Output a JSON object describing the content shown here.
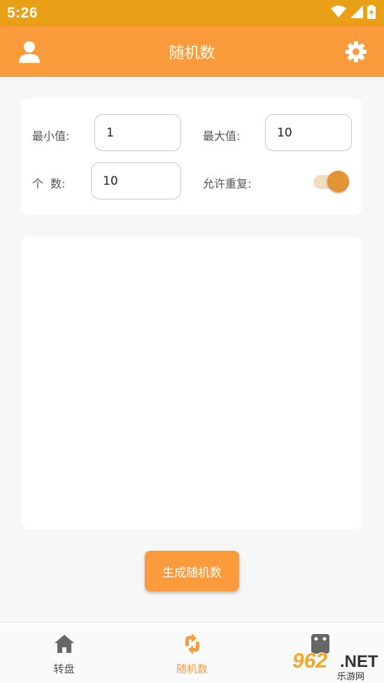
{
  "status_bar": {
    "time": "5:26",
    "icons": [
      "wifi-icon",
      "signal-icon",
      "battery-charging-icon"
    ]
  },
  "app_bar": {
    "title": "随机数",
    "left_icon": "user-icon",
    "right_icon": "gear-icon"
  },
  "settings": {
    "min_label": "最小值:",
    "min_value": "1",
    "max_label": "最大值:",
    "max_value": "10",
    "count_label": "个  数:",
    "count_value": "10",
    "repeat_label": "允许重复:",
    "repeat_enabled": true
  },
  "results": [],
  "generate_button": "生成随机数",
  "bottom_nav": {
    "items": [
      {
        "label": "转盘",
        "icon": "home-icon",
        "active": false
      },
      {
        "label": "随机数",
        "icon": "refresh-arrows-icon",
        "active": true
      },
      {
        "label": "",
        "icon": "dice-icon",
        "active": false
      }
    ]
  },
  "watermark": {
    "number": "962",
    "domain": ".NET",
    "subtitle": "乐游网"
  },
  "colors": {
    "status_bar": "#e9a016",
    "primary": "#fb9b3b",
    "switch_thumb": "#e29533",
    "background": "#f7f7f7"
  }
}
